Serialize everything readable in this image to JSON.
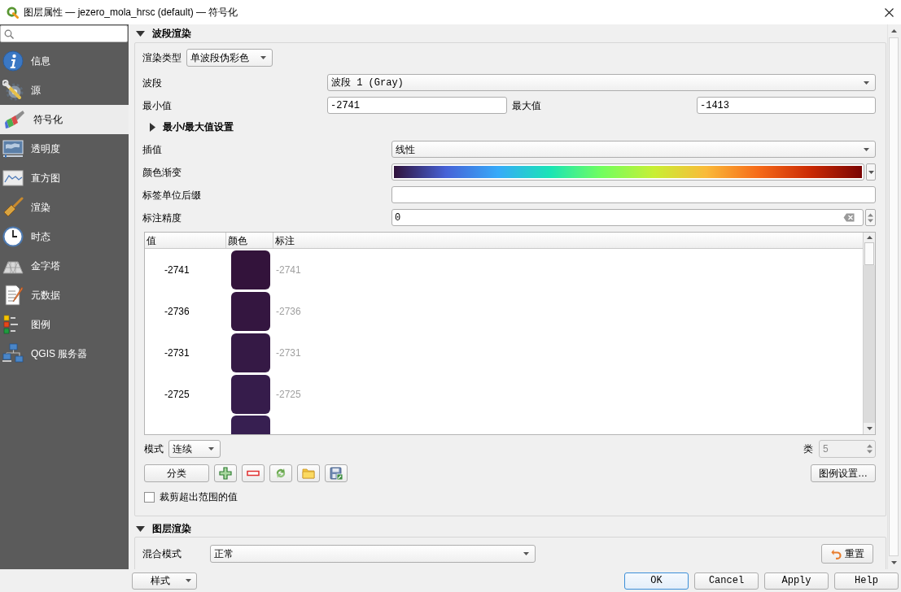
{
  "window": {
    "title": "图层属性 — jezero_mola_hrsc (default) — 符号化"
  },
  "sidebar": {
    "items": [
      {
        "label": "信息",
        "selected": false
      },
      {
        "label": "源",
        "selected": false
      },
      {
        "label": "符号化",
        "selected": true
      },
      {
        "label": "透明度",
        "selected": false
      },
      {
        "label": "直方图",
        "selected": false
      },
      {
        "label": "渲染",
        "selected": false
      },
      {
        "label": "时态",
        "selected": false
      },
      {
        "label": "金字塔",
        "selected": false
      },
      {
        "label": "元数据",
        "selected": false
      },
      {
        "label": "图例",
        "selected": false
      },
      {
        "label": "QGIS 服务器",
        "selected": false
      }
    ]
  },
  "band_rendering": {
    "title": "波段渲染",
    "expanded": true,
    "render_type": {
      "label": "渲染类型",
      "value": "单波段伪彩色"
    },
    "band": {
      "label": "波段",
      "value": "波段 1 (Gray)"
    },
    "min": {
      "label": "最小值",
      "value": "-2741"
    },
    "max": {
      "label": "最大值",
      "value": "-1413"
    },
    "min_max_settings": {
      "title": "最小/最大值设置",
      "expanded": false
    },
    "interpolation": {
      "label": "插值",
      "value": "线性"
    },
    "color_ramp": {
      "label": "颜色渐变"
    },
    "label_unit_suffix": {
      "label": "标签单位后缀"
    },
    "label_precision": {
      "label": "标注精度",
      "value": "0"
    },
    "table": {
      "columns": [
        "值",
        "颜色",
        "标注"
      ],
      "rows": [
        {
          "value": "-2741",
          "color": "#33133b",
          "label": "-2741"
        },
        {
          "value": "-2736",
          "color": "#341640",
          "label": "-2736"
        },
        {
          "value": "-2731",
          "color": "#351945",
          "label": "-2731"
        },
        {
          "value": "-2725",
          "color": "#361c4b",
          "label": "-2725"
        },
        {
          "color": "#371f51"
        }
      ]
    },
    "mode": {
      "label": "模式",
      "value": "连续"
    },
    "classes": {
      "label": "类",
      "value": "5",
      "disabled": true
    },
    "classify_button": "分类",
    "legend_settings_button": "图例设置…",
    "clip_checkbox": {
      "label": "裁剪超出范围的值",
      "checked": false
    }
  },
  "layer_rendering": {
    "title": "图层渲染",
    "expanded": true,
    "blend_mode": {
      "label": "混合模式",
      "value": "正常"
    },
    "reset_button": "重置"
  },
  "footer": {
    "style_button": "样式",
    "buttons": [
      {
        "label": "OK",
        "default": true
      },
      {
        "label": "Cancel",
        "default": false
      },
      {
        "label": "Apply",
        "default": false
      },
      {
        "label": "Help",
        "default": false
      }
    ]
  }
}
